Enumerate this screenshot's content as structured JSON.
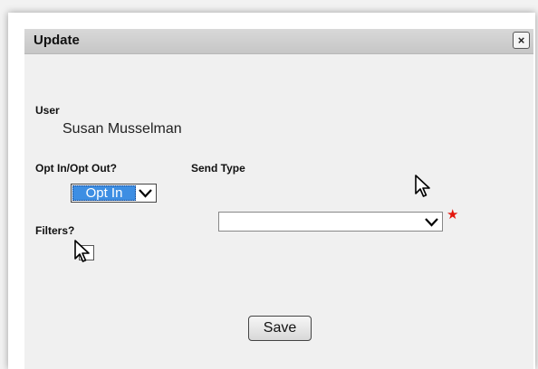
{
  "dialog": {
    "title": "Update",
    "close_label": "×"
  },
  "form": {
    "user_label": "User",
    "user_value": "Susan Musselman",
    "opt_label": "Opt In/Opt Out?",
    "opt_value": "Opt In",
    "send_type_label": "Send Type",
    "send_type_value": "",
    "required_mark": "★",
    "filters_label": "Filters?",
    "filters_checked": false,
    "save_label": "Save"
  },
  "icons": [
    "close-icon",
    "chevron-down-icon",
    "required-star-icon",
    "mouse-cursor-icon"
  ],
  "colors": {
    "selection": "#3d8ee3",
    "required": "#e3160c",
    "titlebar": "#c8c8c8",
    "panel": "#f0f0f0"
  }
}
